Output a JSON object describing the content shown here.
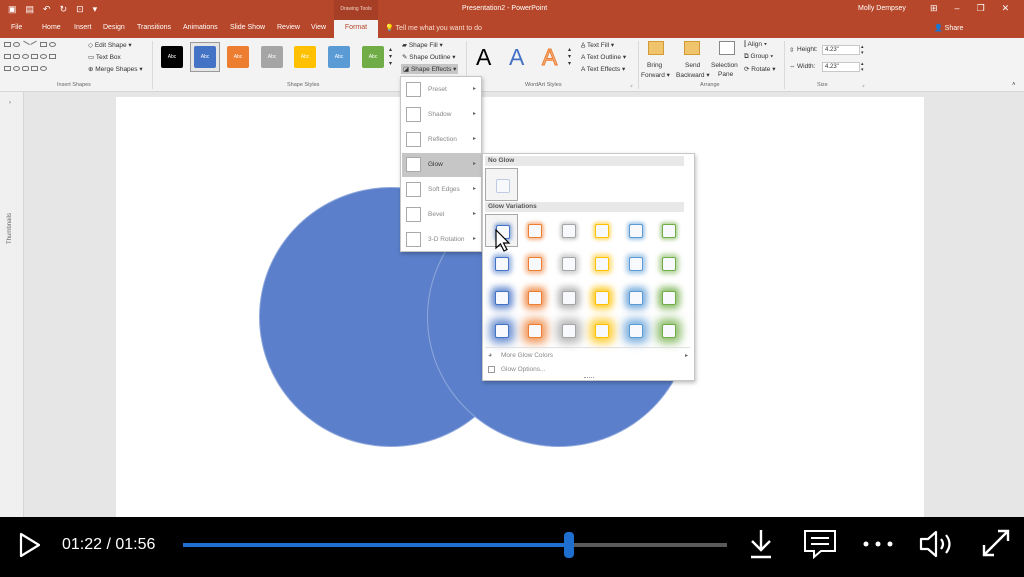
{
  "titlebar": {
    "contextual_group": "Drawing Tools",
    "document_title": "Presentation2 - PowerPoint",
    "user": "Molly Dempsey"
  },
  "tabs": [
    "File",
    "Home",
    "Insert",
    "Design",
    "Transitions",
    "Animations",
    "Slide Show",
    "Review",
    "View"
  ],
  "active_tab": "Format",
  "tell_me": "Tell me what you want to do",
  "share": "Share",
  "ribbon": {
    "insert_shapes": {
      "edit_shape": "Edit Shape",
      "text_box": "Text Box",
      "merge_shapes": "Merge Shapes",
      "label": "Insert Shapes"
    },
    "shape_styles": {
      "swatch_text": "Abc",
      "swatch_colors": [
        "#000000",
        "#4472c4",
        "#ed7d31",
        "#a5a5a5",
        "#ffc000",
        "#5b9bd5",
        "#70ad47"
      ],
      "shape_fill": "Shape Fill",
      "shape_outline": "Shape Outline",
      "shape_effects": "Shape Effects",
      "label": "Shape Styles"
    },
    "wordart_styles": {
      "sample": "A",
      "text_fill": "Text Fill",
      "text_outline": "Text Outline",
      "text_effects": "Text Effects",
      "label": "WordArt Styles"
    },
    "arrange": {
      "bring_forward_1": "Bring",
      "bring_forward_2": "Forward",
      "send_backward_1": "Send",
      "send_backward_2": "Backward",
      "selection_pane_1": "Selection",
      "selection_pane_2": "Pane",
      "align": "Align",
      "group": "Group",
      "rotate": "Rotate",
      "label": "Arrange"
    },
    "size": {
      "height_label": "Height:",
      "height_value": "4.23\"",
      "width_label": "Width:",
      "width_value": "4.23\"",
      "label": "Size"
    }
  },
  "thumbnails_label": "Thumbnails",
  "shape_effects_menu": {
    "items": [
      {
        "label": "Preset"
      },
      {
        "label": "Shadow"
      },
      {
        "label": "Reflection"
      },
      {
        "label": "Glow"
      },
      {
        "label": "Soft Edges"
      },
      {
        "label": "Bevel"
      },
      {
        "label": "3-D Rotation"
      }
    ],
    "active_item": "Glow"
  },
  "glow_menu": {
    "no_glow_header": "No Glow",
    "variations_header": "Glow Variations",
    "glow_colors": [
      "#4472c4",
      "#ed7d31",
      "#a5a5a5",
      "#ffc000",
      "#5b9bd5",
      "#70ad47"
    ],
    "more_glow_colors": "More Glow Colors",
    "glow_options": "Glow Options..."
  },
  "player": {
    "current_time": "01:22",
    "total_time": "01:56",
    "time_display": "01:22 / 01:56",
    "progress": 0.71
  }
}
